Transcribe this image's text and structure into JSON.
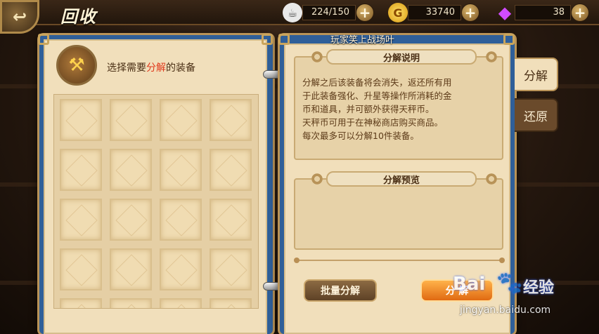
{
  "topbar": {
    "title": "回收",
    "back_icon": "back-arrow-icon",
    "resources": [
      {
        "name": "stamina",
        "icon": "cup-icon",
        "value": "224/150"
      },
      {
        "name": "gold",
        "icon": "gold-coin-icon",
        "value": "33740"
      },
      {
        "name": "gem",
        "icon": "diamond-icon",
        "value": "38"
      }
    ]
  },
  "left_panel": {
    "instruction_prefix": "选择需要",
    "instruction_highlight": "分解",
    "instruction_suffix": "的装备",
    "slot_count": 20
  },
  "right_panel": {
    "player_name": "玩家笑上战场叶",
    "info_title": "分解说明",
    "info_lines": [
      "分解之后该装备将会消失，返还所有用",
      "于此装备强化、升星等操作所消耗的金",
      "币和道具，并可额外获得天秤币。",
      "天秤币可用于在神秘商店购买商品。",
      "每次最多可以分解10件装备。"
    ],
    "preview_title": "分解预览",
    "batch_button": "批量分解",
    "decompose_button": "分 解"
  },
  "tabs": [
    {
      "label": "分解",
      "active": true
    },
    {
      "label": "还原",
      "active": false
    }
  ],
  "watermark": {
    "logo": "Bai",
    "brand": "经验",
    "url": "jingyan.baidu.com"
  },
  "colors": {
    "highlight": "#e03a1c",
    "book_blue": "#2f5f99",
    "parchment": "#f1dfbb",
    "accent_orange": "#f08a20"
  }
}
